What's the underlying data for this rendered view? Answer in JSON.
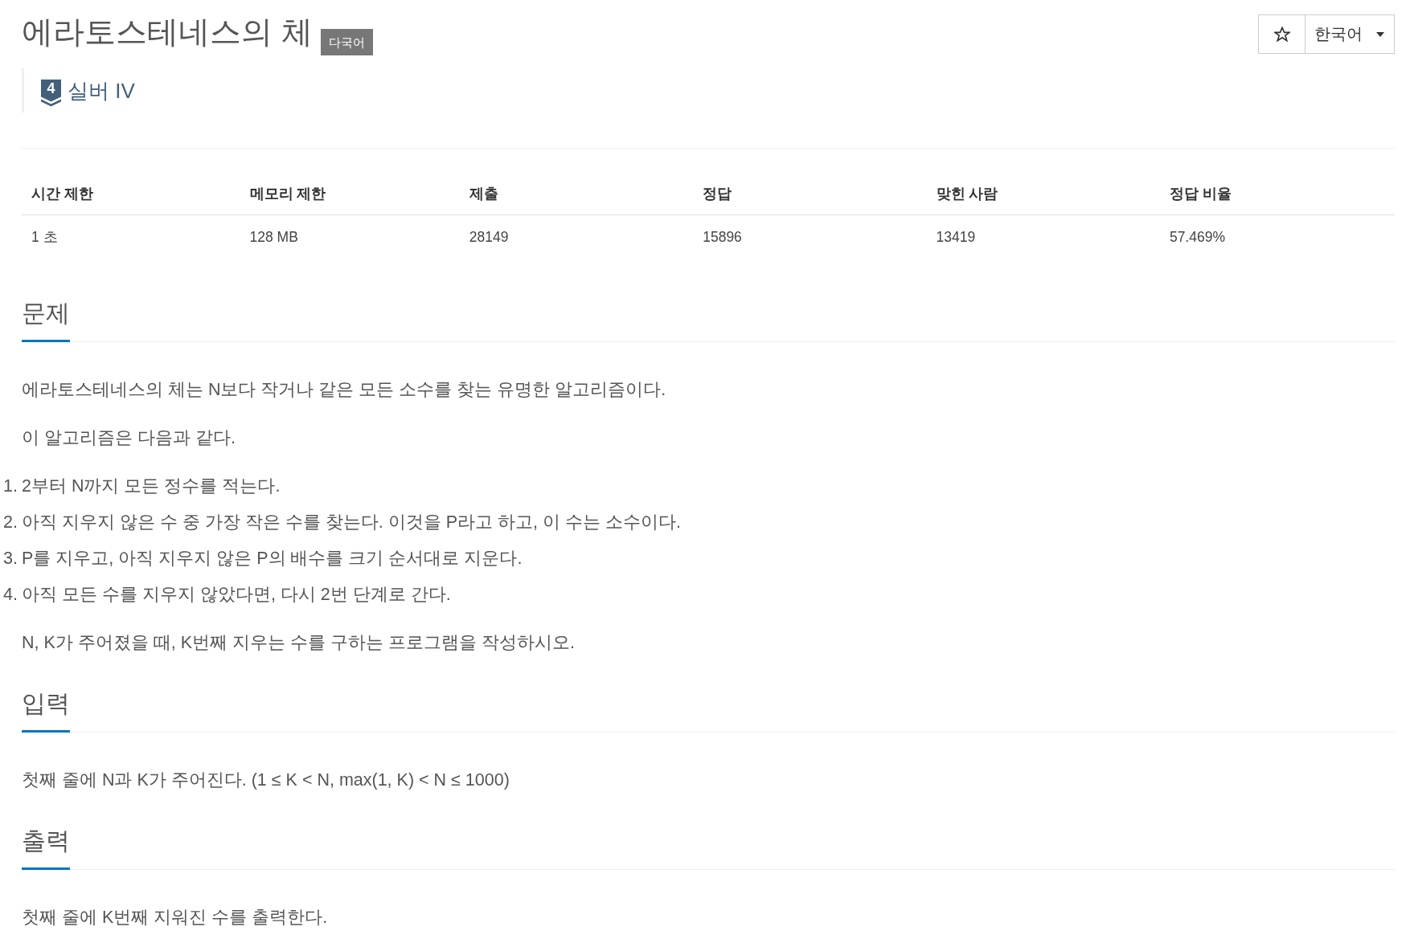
{
  "header": {
    "title": "에라토스테네스의 체",
    "badge": "다국어",
    "tier": {
      "number": "4",
      "label": "실버 IV"
    }
  },
  "toolbar": {
    "favorite": false,
    "language": "한국어"
  },
  "stats": {
    "columns": [
      "시간 제한",
      "메모리 제한",
      "제출",
      "정답",
      "맞힌 사람",
      "정답 비율"
    ],
    "rows": [
      [
        "1 초",
        "128 MB",
        "28149",
        "15896",
        "13419",
        "57.469%"
      ]
    ]
  },
  "sections": [
    {
      "heading": "문제",
      "blocks": [
        {
          "kind": "paragraph",
          "text": "에라토스테네스의 체는 N보다 작거나 같은 모든 소수를 찾는 유명한 알고리즘이다."
        },
        {
          "kind": "paragraph",
          "text": "이 알고리즘은 다음과 같다."
        },
        {
          "kind": "list",
          "items": [
            {
              "number": "1.",
              "text": "2부터 N까지 모든 정수를 적는다."
            },
            {
              "number": "2.",
              "text": "아직 지우지 않은 수 중 가장 작은 수를 찾는다. 이것을 P라고 하고, 이 수는 소수이다."
            },
            {
              "number": "3.",
              "text": "P를 지우고, 아직 지우지 않은 P의 배수를 크기 순서대로 지운다."
            },
            {
              "number": "4.",
              "text": "아직 모든 수를 지우지 않았다면, 다시 2번 단계로 간다."
            }
          ]
        },
        {
          "kind": "paragraph",
          "text": "N, K가 주어졌을 때, K번째 지우는 수를 구하는 프로그램을 작성하시오."
        }
      ]
    },
    {
      "heading": "입력",
      "blocks": [
        {
          "kind": "paragraph",
          "text": "첫째 줄에 N과 K가 주어진다. (1 ≤ K < N, max(1, K) < N ≤ 1000)"
        }
      ]
    },
    {
      "heading": "출력",
      "blocks": [
        {
          "kind": "paragraph",
          "text": "첫째 줄에 K번째 지워진 수를 출력한다."
        }
      ]
    }
  ]
}
